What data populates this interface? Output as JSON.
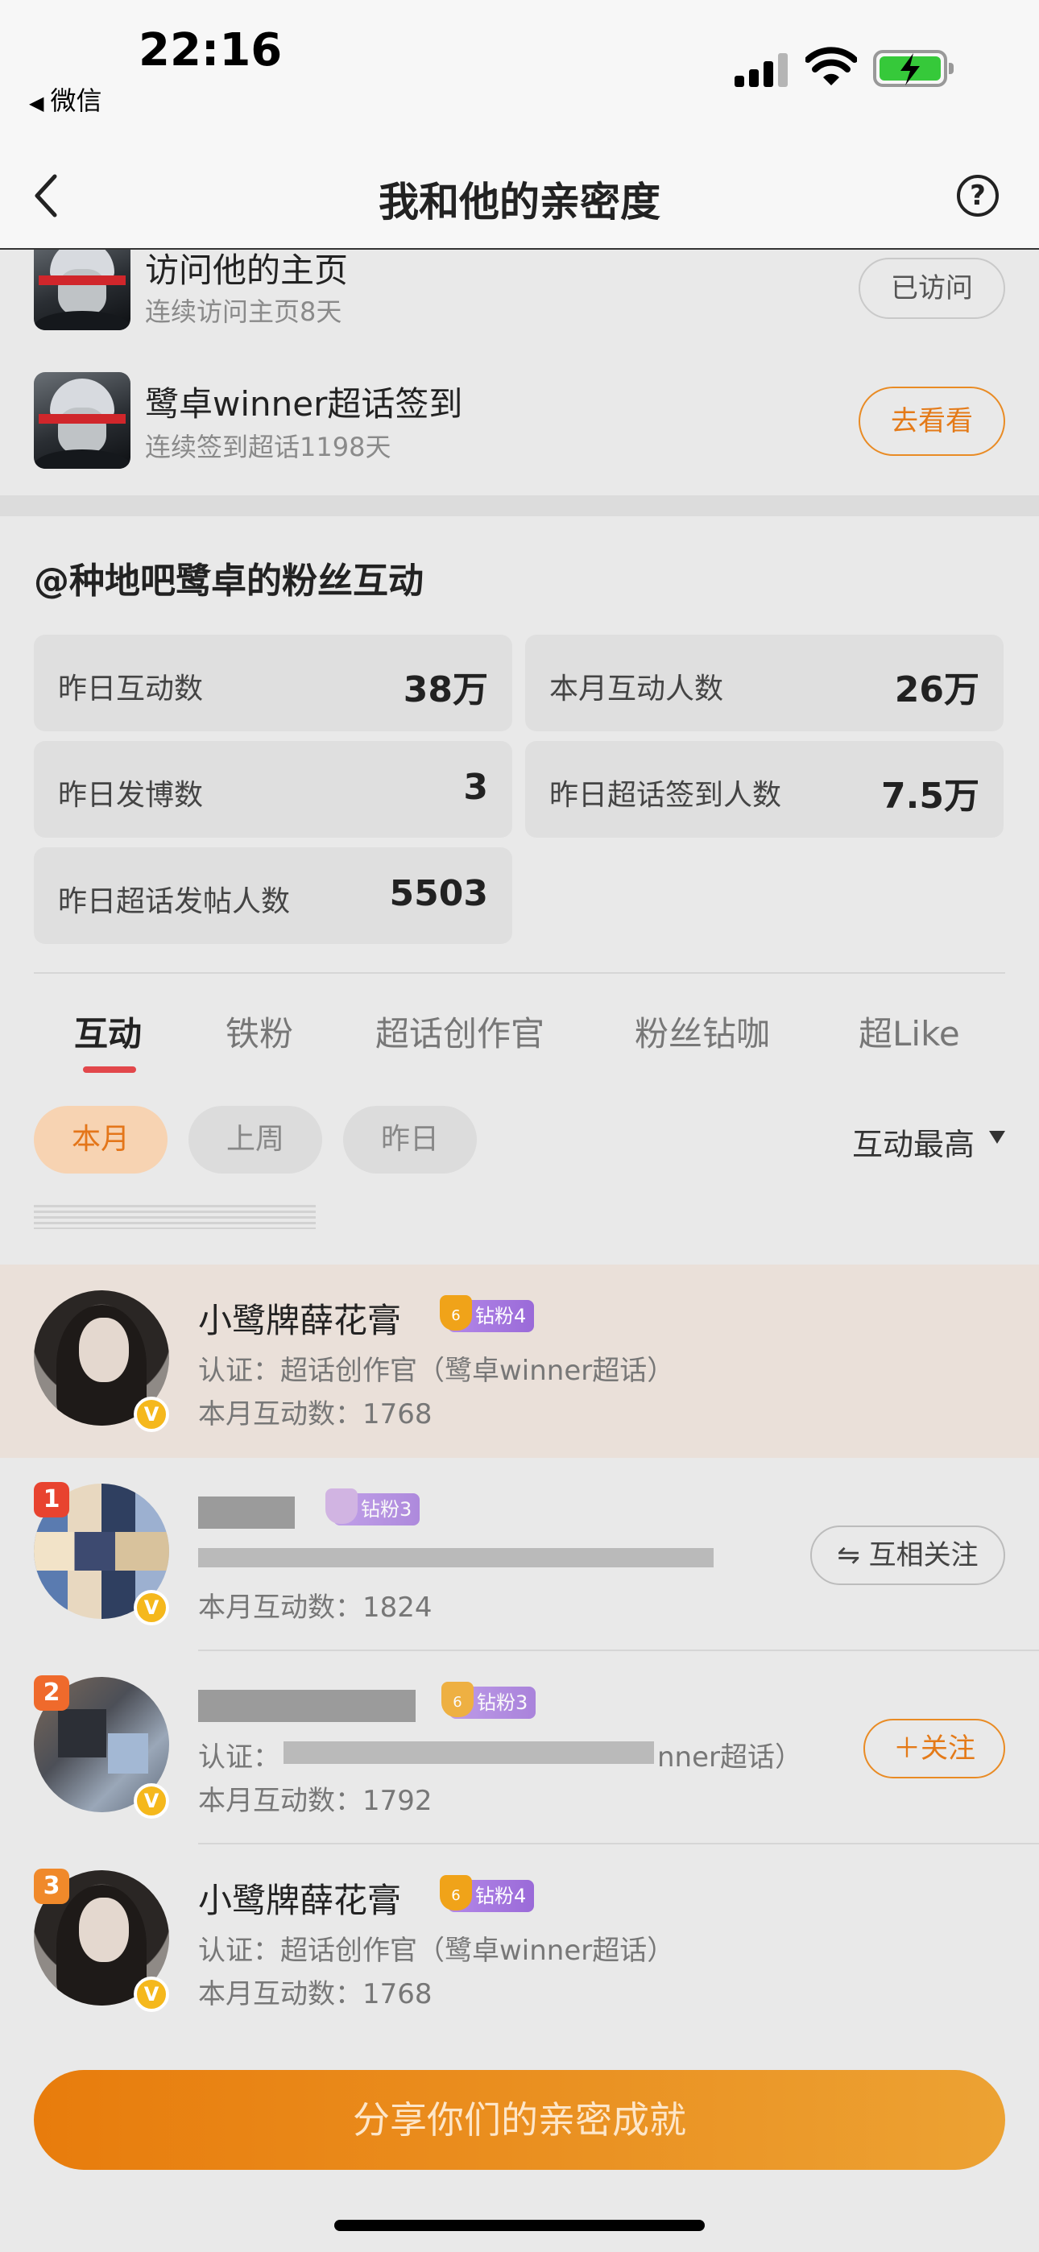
{
  "status_bar": {
    "time": "22:16",
    "back_app": "微信"
  },
  "nav": {
    "title": "我和他的亲密度",
    "help": "?"
  },
  "tasks": [
    {
      "title": "访问他的主页",
      "subtitle": "连续访问主页8天",
      "button": "已访问"
    },
    {
      "title": "鹭卓winner超话签到",
      "subtitle": "连续签到超话1198天",
      "button": "去看看"
    }
  ],
  "fan_section": {
    "title": "@种地吧鹭卓的粉丝互动",
    "stats": [
      {
        "label": "昨日互动数",
        "value": "38万"
      },
      {
        "label": "本月互动人数",
        "value": "26万"
      },
      {
        "label": "昨日发博数",
        "value": "3"
      },
      {
        "label": "昨日超话签到人数",
        "value": "7.5万"
      },
      {
        "label": "昨日超话发帖人数",
        "value": "5503"
      }
    ]
  },
  "tabs": [
    "互动",
    "铁粉",
    "超话创作官",
    "粉丝钻咖",
    "超Like"
  ],
  "filters": {
    "pills": [
      "本月",
      "上周",
      "昨日"
    ],
    "sort": "互动最高"
  },
  "ranking": [
    {
      "rank": "",
      "name": "小鹭牌薛花膏",
      "badge": "钻粉4",
      "badge_level": "6",
      "cert": "认证：超话创作官（鹭卓winner超话）",
      "count": "本月互动数：1768",
      "button": ""
    },
    {
      "rank": "1",
      "name": "",
      "badge": "钻粉3",
      "badge_level": "",
      "cert": "",
      "count": "本月互动数：1824",
      "button": "⇋ 互相关注"
    },
    {
      "rank": "2",
      "name": "",
      "badge": "钻粉3",
      "badge_level": "6",
      "cert": "认证：",
      "cert_tail": "nner超话）",
      "count": "本月互动数：1792",
      "button": "＋关注"
    },
    {
      "rank": "3",
      "name": "小鹭牌薛花膏",
      "badge": "钻粉4",
      "badge_level": "6",
      "cert": "认证：超话创作官（鹭卓winner超话）",
      "count": "本月互动数：1768",
      "button": ""
    }
  ],
  "share_button": "分享你们的亲密成就",
  "colors": {
    "accent": "#e47a18",
    "rank_1": "#e8432f",
    "rank_2": "#ef6a2c",
    "rank_3": "#f0892a",
    "badge": "#a678e2"
  }
}
